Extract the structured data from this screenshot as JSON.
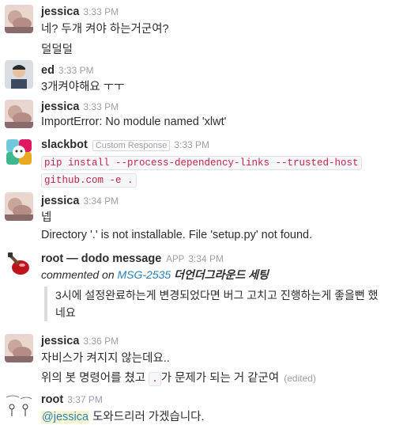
{
  "messages": [
    {
      "sender": "jessica",
      "time": "3:33 PM",
      "lines": [
        "네? 두개 켜야 하는거군여?",
        "덜덜덜"
      ]
    },
    {
      "sender": "ed",
      "time": "3:33 PM",
      "lines": [
        "3개켜야해요 ㅜㅜ"
      ]
    },
    {
      "sender": "jessica",
      "time": "3:33 PM",
      "lines": [
        "ImportError: No module named 'xlwt'"
      ]
    },
    {
      "sender": "slackbot",
      "badge": "Custom Response",
      "time": "3:33 PM",
      "code_line1": "pip install --process-dependency-links --trusted-host",
      "code_line2": "github.com -e ."
    },
    {
      "sender": "jessica",
      "time": "3:34 PM",
      "lines": [
        "넵",
        "Directory '.' is not installable. File 'setup.py' not found."
      ]
    },
    {
      "sender": "root — dodo message",
      "app": "APP",
      "time": "3:34 PM",
      "commented": "commented on",
      "issue": "MSG-2535",
      "issue_title": "더언더그라운드 세팅",
      "quote_line1": "3시에 설정완료하는게 변경되었다면 버그 고치고 진행하는게 좋을뻔 했",
      "quote_line2": "네요"
    },
    {
      "sender": "jessica",
      "time": "3:36 PM",
      "line1": "자비스가 켜지지 않는데요..",
      "line2_before": "위의 봇 명령어를 쳤고",
      "line2_code": ".",
      "line2_after": "가 문제가 되는 거 같군여",
      "edited": "(edited)"
    },
    {
      "sender": "root",
      "time": "3:37 PM",
      "mention": "@jessica",
      "after_mention": "도와드리러 가겠습니다."
    }
  ],
  "icons": {
    "jessica": "jessica-avatar-icon",
    "ed": "ed-avatar-icon",
    "slackbot": "slackbot-avatar-icon",
    "dodo": "wine-glass-avatar-icon",
    "root": "sketch-avatar-icon"
  }
}
